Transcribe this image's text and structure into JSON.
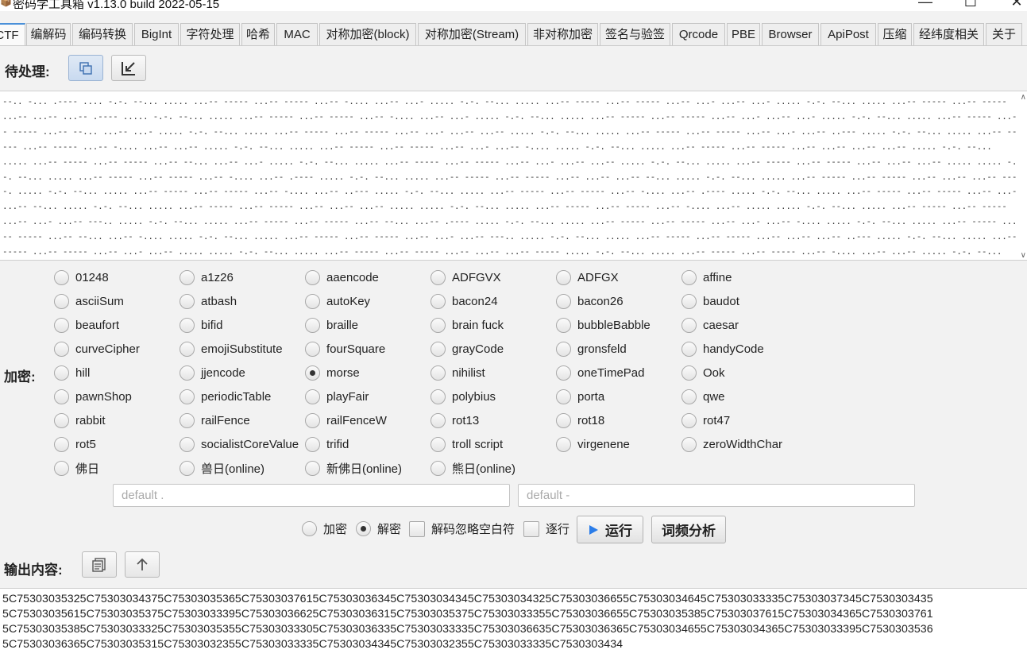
{
  "window": {
    "title": "密码学工具箱 v1.13.0 build 2022-05-15",
    "icon": "toolbox-icon",
    "minimize": "—",
    "maximize": "☐",
    "close": "✕"
  },
  "tabs": [
    "CTF",
    "编解码",
    "编码转换",
    "BigInt",
    "字符处理",
    "哈希",
    "MAC",
    "对称加密(block)",
    "对称加密(Stream)",
    "非对称加密",
    "签名与验签",
    "Qrcode",
    "PBE",
    "Browser",
    "ApiPost",
    "压缩",
    "经纬度相关",
    "关于"
  ],
  "active_tab": "CTF",
  "input_section": {
    "label": "待处理:",
    "copy_button_icon": "copy-icon",
    "import_button_icon": "import-icon",
    "text": "--.. -... .---- .... -.-. --... ..... ...-- ----- ...-- ----- ...-- -.... ...-- ...- ..... -.-. --... ..... ...-- ----- ...-- ----- ...-- ...- ...-- ...- ..... -.-. --... ..... ...-- ----- ...-- ----- ...-- ...-- ...-- .---- ..... -.-. --... ..... ...-- ----- ...-- ----- ...-- -.... ...-- ...- ..... -.-. --... ..... ...-- ----- ...-- ----- ...-- ...- ...-- ...- ..... -.-. --... ..... ...-- ----- ...-- ----- ...-- --... ...-- ...- ..... -.-. --... ..... ...-- ----- ...-- ----- ...-- ...- ...-- ...-- ..... -.-. --... ..... ...-- ----- ...-- ----- ...-- ...- ...-- ..--- ..... -.-. --... ..... ...-- ----- ...-- ----- ...-- -.... ...-- ...-- ..... -.-. --... ..... ...-- ----- ...-- ----- ...-- ...- ...-- -.... ..... -.-. --... ..... ...-- ----- ...-- ----- ...-- ...-- ...-- ...-- ..... -.-. --... ..... ...-- ----- ...-- ----- ...-- --... ...-- ...- ..... -.-. --... ..... ...-- ----- ...-- ----- ...-- ...- ...-- ...-- ..... -.-. --... ..... ...-- ----- ...-- ----- ...-- ...-- ...-- ..... ..... -.-. --... ..... ...-- ----- ...-- ----- ...-- -.... ...-- .---- ..... -.-. --... ..... ...-- ----- ...-- ----- ...-- ...-- ...-- --... ..... -.-. --... ..... ...-- ----- ...-- ----- ...-- ...-- ...-- ----. ..... -.-. --... ..... ...-- ----- ...-- ----- ...-- -.... ...-- ..--- ..... -.-. --... ..... ...-- ----- ...-- ----- ...-- -.... ...-- .---- ..... -.-. --... ..... ...-- ----- ...-- ----- ...-- ...- ...-- --... ..... -.-. --... ..... ...-- ----- ...-- ----- ...-- ...-- ...-- ..... ..... -.-. --... ..... ...-- ----- ...-- ----- ...-- -.... ...-- ..... ..... -.-. --... ..... ...-- ----- ...-- ----- ...-- ...- ...-- ---.. ..... -.-. --... ..... ...-- ----- ...-- ----- ...-- --... ...-- .---- ..... -.-. --... ..... ...-- ----- ...-- ----- ...-- ...- ...-- -.... ..... -.-. --... ..... ...-- ----- ...-- ----- ...-- --... ...-- -.... ..... -.-. --... ..... ...-- ----- ...-- ----- ...-- ...- ...-- ---.. ..... -.-. --... ..... ...-- ----- ...-- ----- ...-- ...-- ...-- ..--- ..... -.-. --... ..... ...-- ----- ...-- ----- ...-- ...- ...-- ..... ..... -.-. --... ..... ...-- ----- ...-- ----- ...-- ...-- ...-- ----- ..... -.-. --... ..... ...-- ----- ...-- ----- ...-- -.... ...-- ...-- ..... -.-. --... ..... ...-- ----- ...-- ----- ...-- ...-- ...-- ...-- ..... -.-. --... ..... ...-- ----- ...-- ----- ...-- -.... ...-- ...-- ..... -.-. --... ..... ...-- ----- ...-- ----- ...-- -.... ...-- -.... ..... -.-. --... ..... ...-- ----- ...-- ----- ...-- ...- ...-- ...- ..... -.-. --... ..... ...-- ----- ...-- ----- ...-- ...- ...-- -.... ..... -.-. --... ..... ...-- ----- ...-- ----- ...-- ...-- ...-- ----. ..... -.-. --... ..... ...-- ----- ...-- ----- ...-- ...- ...-- -.... ..... -.-. --... ..... ...-- ----- ...-- ----- ...-- -.... ...-- -.... ..... -.-. --... ..... ...-- ----- ...-- ----- ...-- ...- ...-- .---- ..... -.-. --... ..... ...-- ----- ...-- ----- ...-- ..--- ...-- ..... ..... -.-. --... ..... ...-- ----- ...-- ----- ...-- ...-- ...-- ...-- ..... -.-. --... ..... ...-- ----- ...-- ----- ...-- ...- ...-- ...- ..... -.-. --... ..... ...-- ----- ...-- ----- ...-- ..--- ...-- ..... ..... -.-. --... ..... ...-- ----- ...-- ----- ...-- ...-- ...-- ...-- ..... -.-. --... ..... ...-- ----- ...-- ----- ...-- ...- ...-"
  },
  "cipher_section": {
    "label": "加密:",
    "selected": "morse",
    "options": [
      [
        "01248",
        "a1z26",
        "aaencode",
        "ADFGVX",
        "ADFGX",
        "affine"
      ],
      [
        "asciiSum",
        "atbash",
        "autoKey",
        "bacon24",
        "bacon26",
        "baudot"
      ],
      [
        "beaufort",
        "bifid",
        "braille",
        "brain fuck",
        "bubbleBabble",
        "caesar"
      ],
      [
        "curveCipher",
        "emojiSubstitute",
        "fourSquare",
        "grayCode",
        "gronsfeld",
        "handyCode"
      ],
      [
        "hill",
        "jjencode",
        "morse",
        "nihilist",
        "oneTimePad",
        "Ook"
      ],
      [
        "pawnShop",
        "periodicTable",
        "playFair",
        "polybius",
        "porta",
        "qwe"
      ],
      [
        "rabbit",
        "railFence",
        "railFenceW",
        "rot13",
        "rot18",
        "rot47"
      ],
      [
        "rot5",
        "socialistCoreValue",
        "trifid",
        "troll script",
        "virgenene",
        "zeroWidthChar"
      ],
      [
        "佛日",
        "兽日(online)",
        "新佛日(online)",
        "熊日(online)"
      ]
    ]
  },
  "params": {
    "key1_placeholder": "default .",
    "key2_placeholder": "default -"
  },
  "options_row": {
    "encrypt_label": "加密",
    "decrypt_label": "解密",
    "mode_selected": "decrypt",
    "ignore_whitespace_label": "解码忽略空白符",
    "per_line_label": "逐行",
    "run_label": "运行",
    "run_icon": "play-icon",
    "freq_label": "词频分析"
  },
  "output_section": {
    "label": "输出内容:",
    "copy_button_icon": "copy-icon",
    "up_button_icon": "arrow-up-icon",
    "lines": [
      "5C75303035325C75303034375C75303035365C75303037615C75303036345C75303034345C75303034325C75303036655C75303034645C75303033335C75303037345C7530303435",
      "5C75303035615C75303035375C75303033395C75303036625C75303036315C75303035375C75303033355C75303036655C75303035385C75303037615C75303034365C7530303761",
      "5C75303035385C75303033325C75303035355C75303033305C75303036335C75303033335C75303036635C75303036365C75303034655C75303034365C75303033395C7530303536",
      "5C75303036365C75303035315C75303032355C75303033335C75303034345C75303032355C75303033335C7530303434"
    ]
  },
  "colors": {
    "accent": "#4a90d9",
    "play": "#2b7de9"
  }
}
